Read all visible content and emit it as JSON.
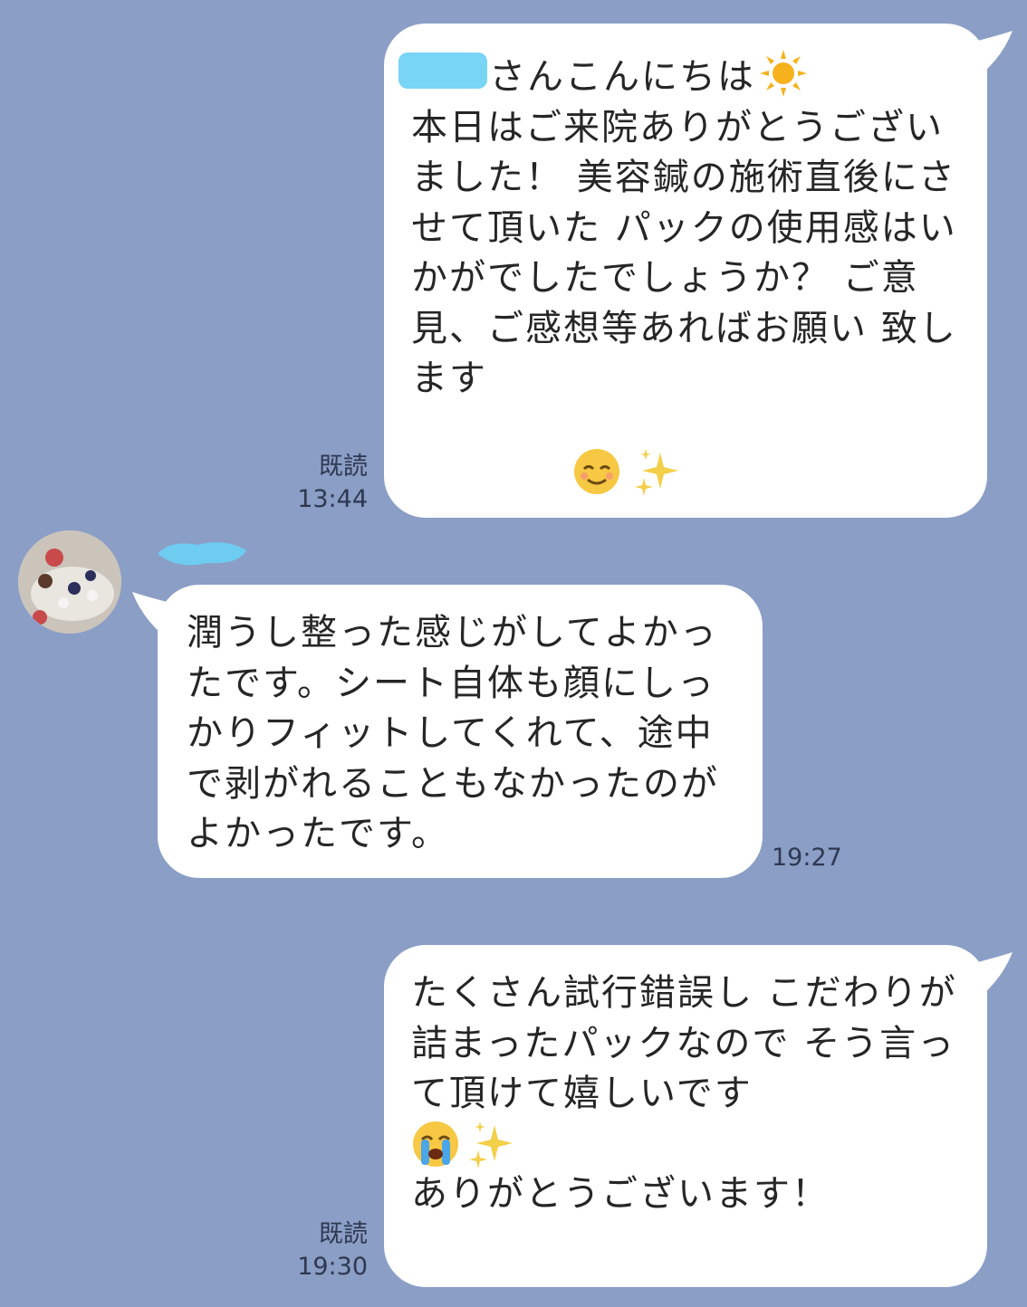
{
  "messages": [
    {
      "sender": "self",
      "greeting": "さんこんにちは",
      "greeting_emoji": "sun-emoji",
      "body": "本日はご来院ありがとうございました！\n美容鍼の施術直後にさせて頂いた\nパックの使用感はいかがでしたでしょうか？\nご意見、ご感想等あればお願い\n致します",
      "trailing_emojis": [
        "relieved-face-emoji",
        "sparkles-emoji"
      ],
      "read_label": "既読",
      "time": "13:44"
    },
    {
      "sender": "other",
      "body": "潤うし整った感じがしてよかったです。シート自体も顔にしっかりフィットしてくれて、途中で剥がれることもなかったのがよかったです。",
      "time": "19:27"
    },
    {
      "sender": "self",
      "body": "たくさん試行錯誤し\nこだわりが詰まったパックなので\nそう言って頂けて嬉しいです",
      "inline_emojis": [
        "crying-face-emoji",
        "sparkles-emoji"
      ],
      "body_end": "ありがとうございます！",
      "read_label": "既読",
      "time": "19:30"
    }
  ],
  "colors": {
    "background": "#8a9ec6",
    "bubble": "#ffffff",
    "redaction": "#6ad0f5"
  }
}
